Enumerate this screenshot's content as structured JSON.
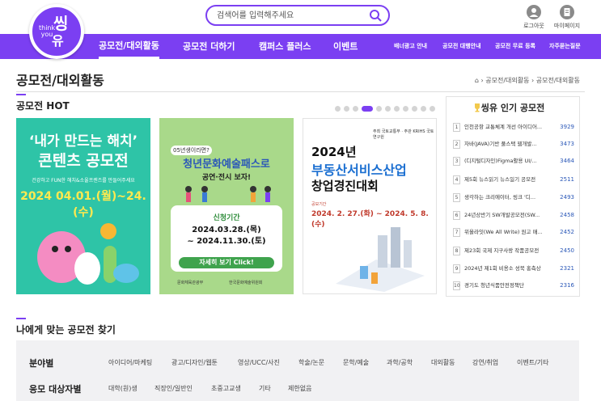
{
  "header": {
    "logo_small": "think you",
    "logo_big_top": "씽",
    "logo_big_bottom": "유",
    "search_placeholder": "검색어를 입력해주세요",
    "login_label": "로그아웃",
    "mypage_label": "마이페이지"
  },
  "nav": {
    "main": [
      "공모전/대외활동",
      "공모전 더하기",
      "캠퍼스 플러스",
      "이벤트"
    ],
    "sub": [
      "배너광고 안내",
      "공모전 대행안내",
      "공모전 무료 등록",
      "자주묻는질문"
    ]
  },
  "page": {
    "title": "공모전/대외활동",
    "breadcrumb": "⌂ › 공모전/대외활동 › 공모전/대외활동"
  },
  "hot": {
    "title": "공모전 HOT",
    "dots_count": 11,
    "active_dot": 3,
    "banners": [
      {
        "line1": "‘내가 만드는 해치’",
        "line2": "콘텐츠 공모전",
        "line3": "건강하고 FUN한 해치&소울프렌즈를 만들어주세요",
        "line4": "2024 04.01.(월)~24.(수)"
      },
      {
        "tag": "05년생이라면?",
        "line1": "청년문화예술패스로",
        "line2": "공연·전시 보자!",
        "period_label": "신청기간",
        "period": "2024.03.28.(목)\n~ 2024.11.30.(토)",
        "button": "자세히 보기 Click!",
        "org1": "문화체육관광부",
        "org2": "한국문화예술위원회"
      },
      {
        "org": "주최 국토교통부 · 주관 KRIHS 국토연구원",
        "line1": "2024년",
        "line2": "부동산서비스산업",
        "line3": "창업경진대회",
        "period_label": "공모기간",
        "period": "2024. 2. 27.(화) ~ 2024. 5. 8.(수)"
      }
    ]
  },
  "popular": {
    "title": "씽유 인기 공모전",
    "items": [
      {
        "rank": "1",
        "name": "인천공항 교통체계 개선 아이디어...",
        "count": "3929"
      },
      {
        "rank": "2",
        "name": "자바(JAVA)기반 풀스택 웹개발...",
        "count": "3473"
      },
      {
        "rank": "3",
        "name": "(디지털디자인)Figma활용 UI/...",
        "count": "3464"
      },
      {
        "rank": "4",
        "name": "제5회 뉴스읽기 뉴스일기 공모전",
        "count": "2511"
      },
      {
        "rank": "5",
        "name": "생각하는 크리에이터, 씽크 '디...",
        "count": "2493"
      },
      {
        "rank": "6",
        "name": "24년상반기 SW개발공모전(SW...",
        "count": "2458"
      },
      {
        "rank": "7",
        "name": "위올라잇(We All Write) 원고 매...",
        "count": "2452"
      },
      {
        "rank": "8",
        "name": "제23회 국제 지구사랑 작품공모전",
        "count": "2450"
      },
      {
        "rank": "9",
        "name": "2024년 제1회 비용소 성북 홍측상",
        "count": "2321"
      },
      {
        "rank": "10",
        "name": "경기도 청년식품안전정책단",
        "count": "2316"
      }
    ]
  },
  "find": {
    "title": "나에게 맞는 공모전 찾기",
    "field_label": "분야별",
    "field_options": [
      "아이디어/마케팅",
      "광고/디자인/웹툰",
      "영상/UCC/사진",
      "학술/논문",
      "문학/예술",
      "과학/공학",
      "대외활동",
      "강연/취업",
      "이벤트/기타"
    ],
    "target_label": "응모 대상자별",
    "target_options": [
      "대학(원)생",
      "직장인/일반인",
      "초중고교생",
      "기타",
      "제한없음"
    ]
  },
  "colors": {
    "brand": "#7b3ff2",
    "count_blue": "#2b58b8",
    "banner1_bg": "#2ec4a7",
    "banner2_bg": "#a9d98a"
  }
}
